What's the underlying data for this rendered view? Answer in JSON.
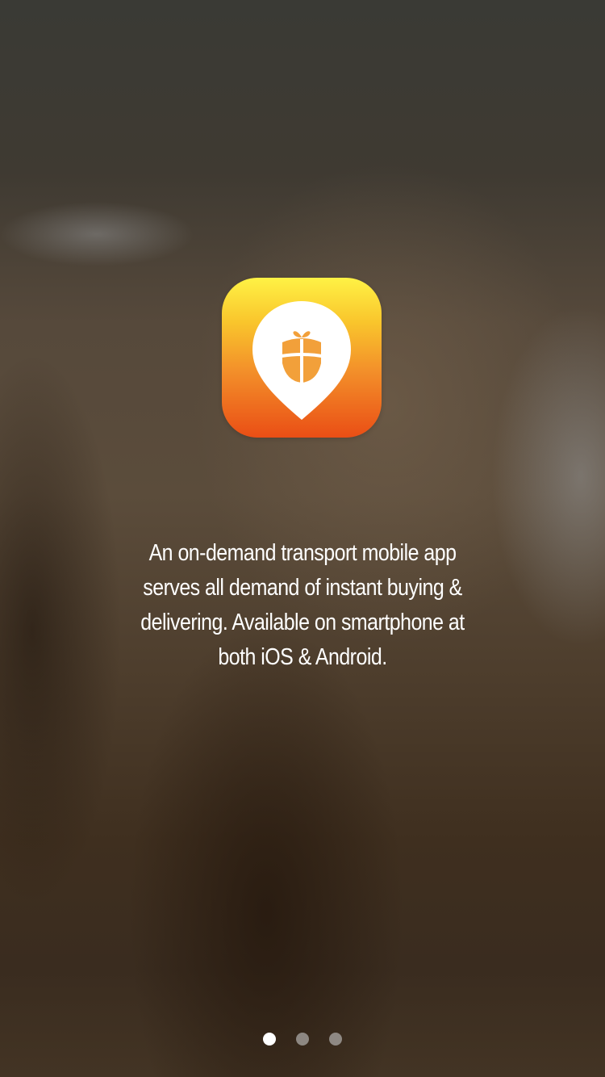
{
  "app": {
    "logo": {
      "icon": "gift-location-pin-icon",
      "gradient_top": "#fff245",
      "gradient_bottom": "#ea4e15",
      "accent": "#f2a03a"
    }
  },
  "onboarding": {
    "description": "An on-demand transport mobile app serves all demand of instant buying & delivering. Available on smartphone at both iOS & Android.",
    "pagination": {
      "total": 3,
      "active_index": 0,
      "colors": {
        "active": "#ffffff",
        "inactive": "#c8c8c8"
      }
    }
  }
}
